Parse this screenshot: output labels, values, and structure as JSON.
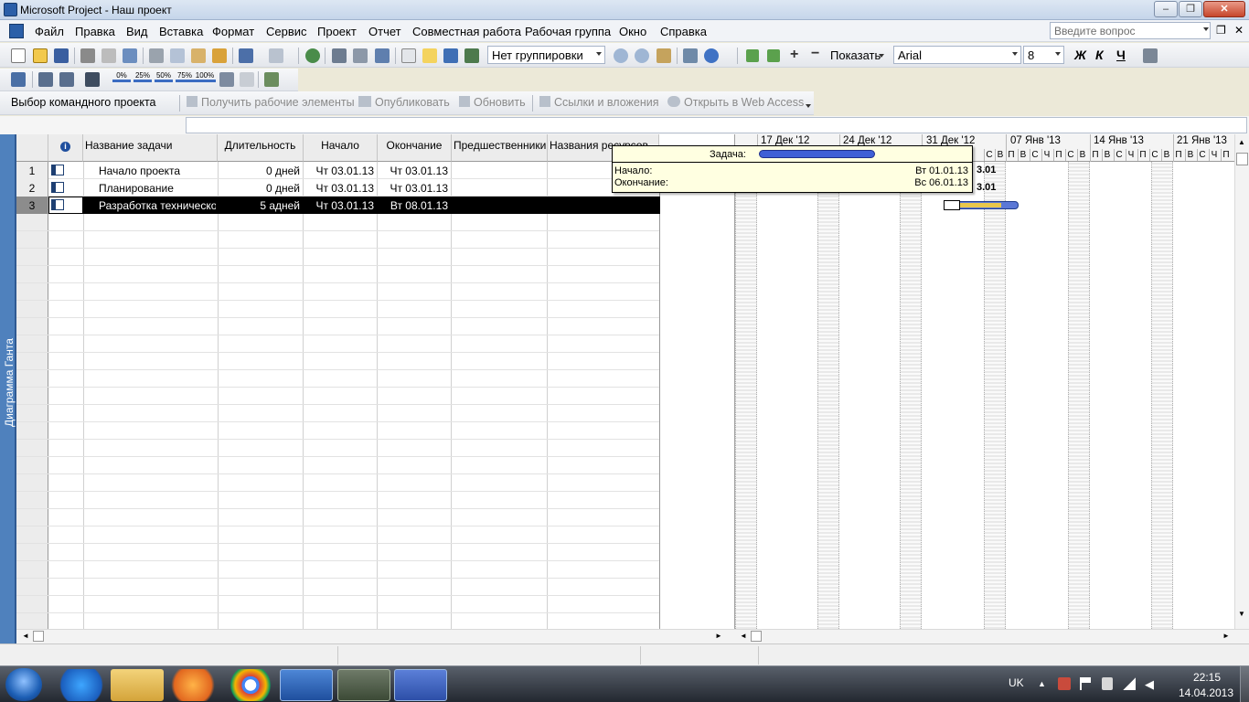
{
  "window": {
    "title": "Microsoft Project - Наш проект"
  },
  "menu": {
    "items": [
      "Файл",
      "Правка",
      "Вид",
      "Вставка",
      "Формат",
      "Сервис",
      "Проект",
      "Отчет",
      "Совместная работа",
      "Рабочая группа",
      "Окно",
      "Справка"
    ],
    "ask_placeholder": "Введите вопрос"
  },
  "toolbar": {
    "grouping": "Нет группировки",
    "show_label": "Показать",
    "font": "Arial",
    "font_size": "8",
    "bold": "Ж",
    "italic": "К",
    "underline": "Ч",
    "percent_buttons": [
      "0%",
      "25%",
      "50%",
      "75%",
      "100%"
    ]
  },
  "team_toolbar": {
    "items": [
      "Выбор командного проекта",
      "Получить рабочие элементы",
      "Опубликовать",
      "Обновить",
      "Ссылки и вложения",
      "Открыть в Web Access"
    ]
  },
  "view": {
    "label": "Диаграмма Ганта"
  },
  "table": {
    "columns": [
      "Название задачи",
      "Длительность",
      "Начало",
      "Окончание",
      "Предшественники",
      "Названия ресурсов"
    ],
    "rows": [
      {
        "num": "1",
        "name": "Начало проекта",
        "duration": "0 дней",
        "start": "Чт 03.01.13",
        "finish": "Чт 03.01.13",
        "pred": "",
        "res": ""
      },
      {
        "num": "2",
        "name": "Планирование",
        "duration": "0 дней",
        "start": "Чт 03.01.13",
        "finish": "Чт 03.01.13",
        "pred": "",
        "res": ""
      },
      {
        "num": "3",
        "name": "Разработка технического",
        "duration": "5 адней",
        "start": "Чт 03.01.13",
        "finish": "Вт 08.01.13",
        "pred": "",
        "res": ""
      }
    ]
  },
  "gantt": {
    "weeks": [
      "17 Дек '12",
      "24 Дек '12",
      "31 Дек '12",
      "07 Янв '13",
      "14 Янв '13",
      "21 Янв '13"
    ],
    "days": [
      "П",
      "В",
      "С",
      "Ч",
      "П",
      "С",
      "В"
    ],
    "milestone_label": "3.01"
  },
  "tooltip": {
    "task_label": "Задача:",
    "start_label": "Начало:",
    "start_value": "Вт 01.01.13",
    "finish_label": "Окончание:",
    "finish_value": "Вс 06.01.13"
  },
  "taskbar": {
    "lang": "UK",
    "time": "22:15",
    "date": "14.04.2013"
  }
}
